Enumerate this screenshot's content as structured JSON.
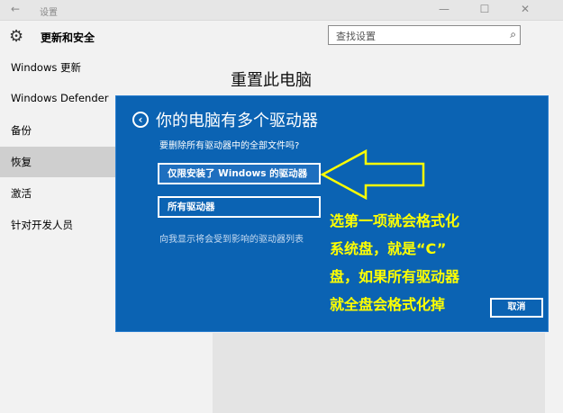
{
  "window": {
    "back_glyph": "←",
    "title": "设置",
    "minimize_glyph": "—",
    "maximize_glyph": "☐",
    "close_glyph": "✕"
  },
  "header": {
    "icon": "gear-icon",
    "title": "更新和安全",
    "search_placeholder": "查找设置",
    "search_icon": "search-icon"
  },
  "sidebar": {
    "items": [
      {
        "label": "Windows 更新"
      },
      {
        "label": "Windows Defender"
      },
      {
        "label": "备份"
      },
      {
        "label": "恢复"
      },
      {
        "label": "激活"
      },
      {
        "label": "针对开发人员"
      }
    ],
    "active_index": 3
  },
  "content": {
    "title": "重置此电脑"
  },
  "dialog": {
    "title": "你的电脑有多个驱动器",
    "subtitle": "要删除所有驱动器中的全部文件吗?",
    "option1": "仅限安装了 Windows 的驱动器",
    "option2": "所有驱动器",
    "link": "向我显示将会受到影响的驱动器列表",
    "cancel": "取消",
    "background_color": "#0b63b3"
  },
  "annotation": {
    "lines": [
      "选第一项就会格式化",
      "系统盘，就是“C”",
      "盘，如果所有驱动器",
      "就全盘会格式化掉"
    ],
    "color": "#ffff00"
  }
}
